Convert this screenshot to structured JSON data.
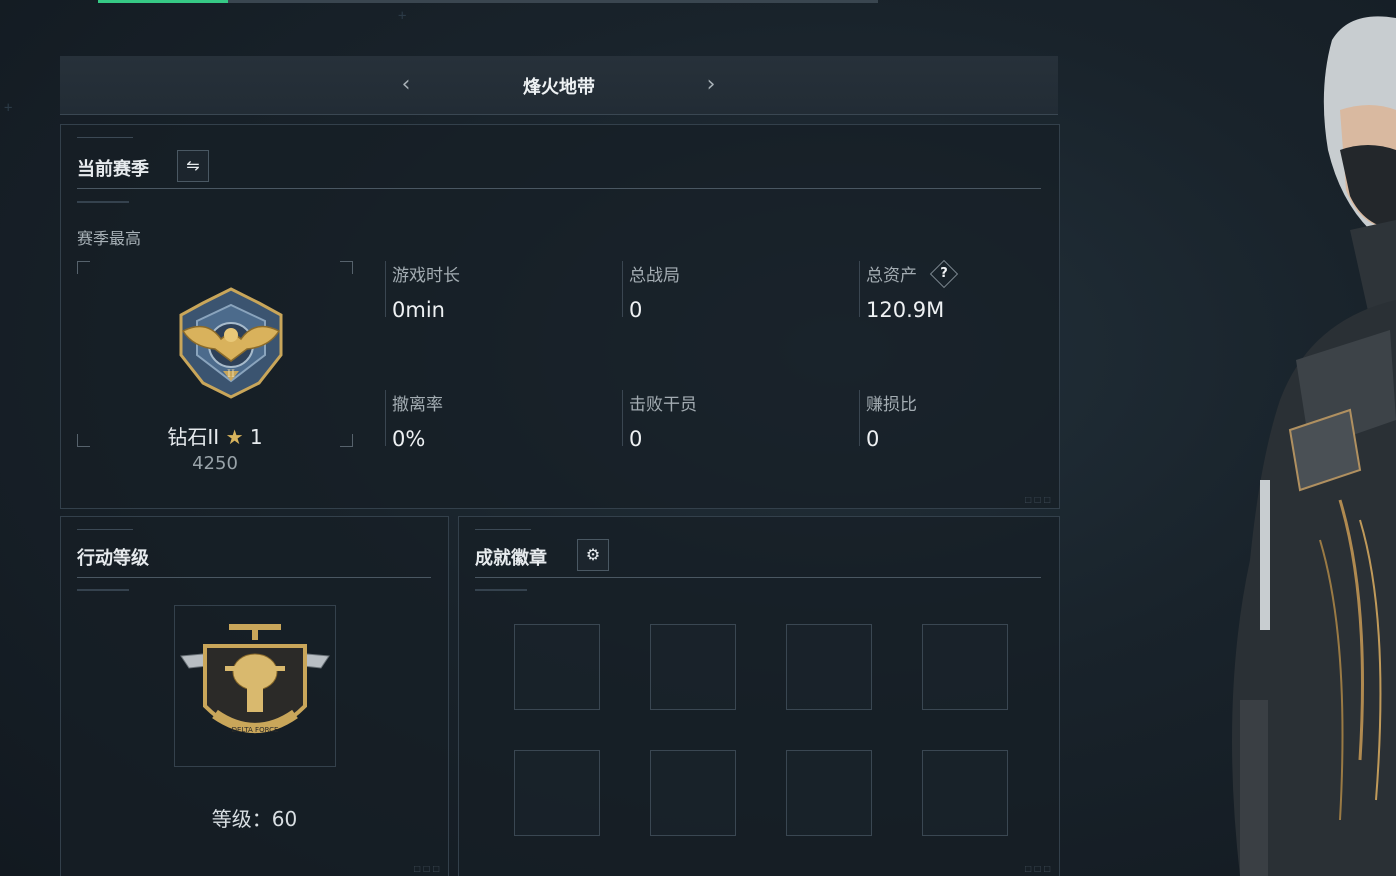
{
  "top_progress": {
    "fraction": 0.167
  },
  "mode_header": {
    "title": "烽火地带",
    "prev_icon": "chevron-left-icon",
    "next_icon": "chevron-right-icon"
  },
  "season_panel": {
    "title": "当前赛季",
    "switch_icon": "swap-arrows-icon",
    "subtitle": "赛季最高",
    "rank": {
      "name": "钻石II",
      "stars": "1",
      "score": "4250",
      "star_icon": "star-icon"
    },
    "stats": [
      {
        "label": "游戏时长",
        "value": "0min"
      },
      {
        "label": "总战局",
        "value": "0"
      },
      {
        "label": "总资产",
        "value": "120.9M",
        "help": "?"
      },
      {
        "label": "撤离率",
        "value": "0%"
      },
      {
        "label": "击败干员",
        "value": "0"
      },
      {
        "label": "赚损比",
        "value": "0"
      }
    ]
  },
  "level_panel": {
    "title": "行动等级",
    "level_text": "等级：60",
    "emblem_text": "DELTA FORCE"
  },
  "badge_panel": {
    "title": "成就徽章",
    "settings_icon": "gear-icon",
    "slot_count": 8
  },
  "colors": {
    "accent_green": "#36c985",
    "gold": "#d8b45d",
    "background": "#141b22"
  }
}
